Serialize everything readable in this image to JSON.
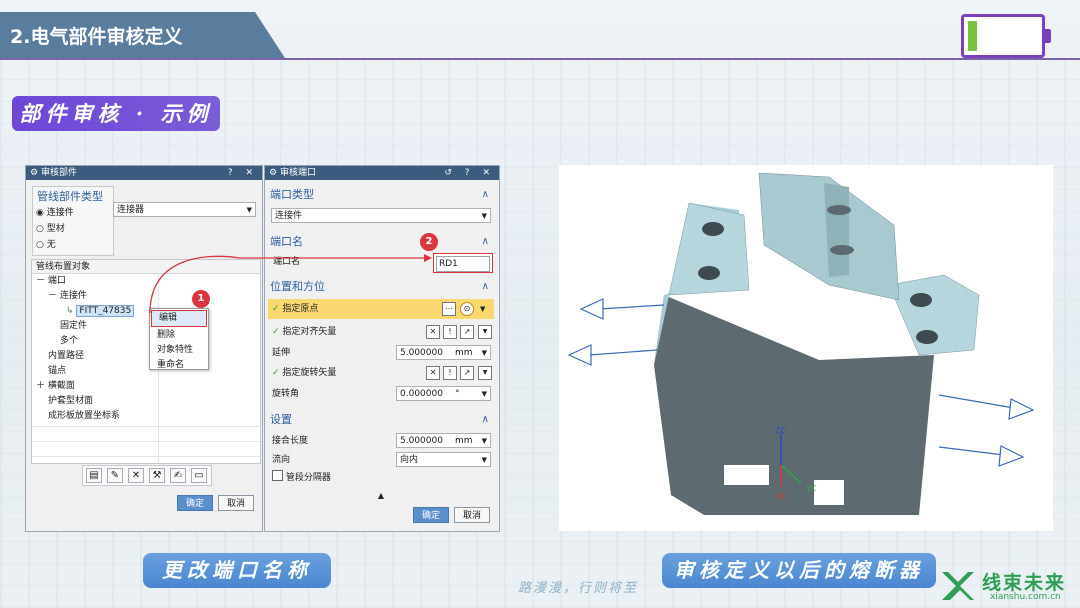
{
  "header": {
    "title": "2.电气部件审核定义"
  },
  "section_title": "部件审核 · 示例",
  "dialog1": {
    "title": "审核部件",
    "title_icons": "? ✕",
    "group_label": "管线部件类型",
    "radio_options": [
      "连接件",
      "型材",
      "无"
    ],
    "selected_radio": "连接件",
    "type_combo": "连接器",
    "tree_header": "管线布置对象",
    "tree": [
      {
        "text": "－ 端口",
        "indent": 0
      },
      {
        "text": "－ 连接件",
        "indent": 1
      },
      {
        "text": "FITT_47835",
        "indent": 2
      },
      {
        "text": "固定件",
        "indent": 2
      },
      {
        "text": "多个",
        "indent": 2
      },
      {
        "text": "内置路径",
        "indent": 1
      },
      {
        "text": "锚点",
        "indent": 1
      },
      {
        "text": "＋ 横截面",
        "indent": 0
      },
      {
        "text": "护套型材面",
        "indent": 1
      },
      {
        "text": "成形板放置坐标系",
        "indent": 1
      }
    ],
    "context_menu": [
      "编辑",
      "删除",
      "对象特性",
      "重命名"
    ],
    "ok_label": "确定",
    "cancel_label": "取消"
  },
  "dialog2": {
    "title": "审核端口",
    "title_icons": "↺ ? ✕",
    "sec_port_type": "端口类型",
    "port_type_value": "连接件",
    "sec_port_name": "端口名",
    "port_name_label": "端口名",
    "port_name_value": "RD1",
    "sec_position": "位置和方位",
    "specify_origin": "指定原点",
    "specify_align_vector": "指定对齐矢量",
    "extend_label": "延伸",
    "extend_value": "5.000000",
    "extend_unit": "mm",
    "specify_rot_vector": "指定旋转矢量",
    "rot_angle_label": "旋转角",
    "rot_angle_value": "0.000000",
    "rot_angle_unit": "°",
    "sec_settings": "设置",
    "engage_len_label": "接合长度",
    "engage_len_value": "5.000000",
    "engage_len_unit": "mm",
    "flow_label": "流向",
    "flow_value": "向内",
    "separator_label": "管段分隔器",
    "ok_label": "确定",
    "cancel_label": "取消"
  },
  "badges": [
    "1",
    "2"
  ],
  "model_axes": {
    "zc": "ZC",
    "xc": "XC",
    "yc": "YC"
  },
  "caption_left": "更改端口名称",
  "caption_right": "审核定义以后的熔断器",
  "motto": "路漫漫，行则将至",
  "logo": {
    "name": "线束未来",
    "url": "xianshu.com.cn"
  },
  "colors": {
    "accent": "#7b63a8",
    "header": "#5a7d9e",
    "title_pill": "#6d46d7",
    "caption": "#4a86d0",
    "badge": "#d9363e",
    "logo_green": "#2f9e54"
  }
}
